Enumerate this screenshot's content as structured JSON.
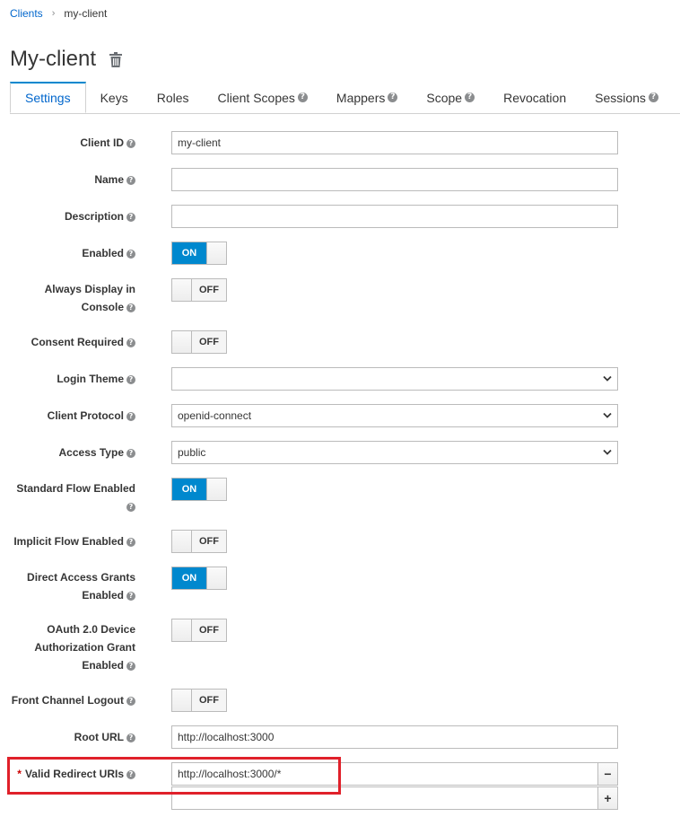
{
  "breadcrumb": {
    "parent": "Clients",
    "separator": "›",
    "current": "my-client"
  },
  "page": {
    "title": "My-client",
    "delete_icon": "trash-icon"
  },
  "tabs": [
    {
      "label": "Settings",
      "active": true,
      "help": false
    },
    {
      "label": "Keys",
      "active": false,
      "help": false
    },
    {
      "label": "Roles",
      "active": false,
      "help": false
    },
    {
      "label": "Client Scopes",
      "active": false,
      "help": true
    },
    {
      "label": "Mappers",
      "active": false,
      "help": true
    },
    {
      "label": "Scope",
      "active": false,
      "help": true
    },
    {
      "label": "Revocation",
      "active": false,
      "help": false
    },
    {
      "label": "Sessions",
      "active": false,
      "help": true
    }
  ],
  "help_glyph": "?",
  "fields": {
    "client_id": {
      "label": "Client ID",
      "value": "my-client"
    },
    "name": {
      "label": "Name",
      "value": ""
    },
    "description": {
      "label": "Description",
      "value": ""
    },
    "enabled": {
      "label": "Enabled",
      "state": "ON"
    },
    "always_display": {
      "label": "Always Display in Console",
      "state": "OFF"
    },
    "consent_required": {
      "label": "Consent Required",
      "state": "OFF"
    },
    "login_theme": {
      "label": "Login Theme",
      "value": ""
    },
    "client_protocol": {
      "label": "Client Protocol",
      "value": "openid-connect"
    },
    "access_type": {
      "label": "Access Type",
      "value": "public"
    },
    "standard_flow": {
      "label": "Standard Flow Enabled",
      "state": "ON"
    },
    "implicit_flow": {
      "label": "Implicit Flow Enabled",
      "state": "OFF"
    },
    "direct_access": {
      "label": "Direct Access Grants Enabled",
      "state": "ON"
    },
    "oauth_device": {
      "label": "OAuth 2.0 Device Authorization Grant Enabled",
      "state": "OFF"
    },
    "front_channel": {
      "label": "Front Channel Logout",
      "state": "OFF"
    },
    "root_url": {
      "label": "Root URL",
      "value": "http://localhost:3000"
    },
    "valid_redirect": {
      "required_mark": "*",
      "label": "Valid Redirect URIs",
      "values": [
        "http://localhost:3000/*",
        ""
      ],
      "remove_symbol": "−",
      "add_symbol": "+"
    }
  },
  "colors": {
    "accent": "#0088ce",
    "link": "#0066cc",
    "highlight": "#e0202a"
  }
}
